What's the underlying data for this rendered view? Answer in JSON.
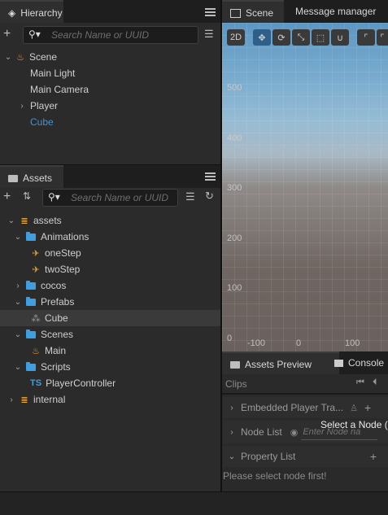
{
  "hierarchy": {
    "tab": "Hierarchy",
    "search_placeholder": "Search Name or UUID",
    "nodes": [
      {
        "label": "Scene",
        "color": "#cfcfcf"
      },
      {
        "label": "Main Light",
        "color": "#cfcfcf"
      },
      {
        "label": "Main Camera",
        "color": "#cfcfcf"
      },
      {
        "label": "Player",
        "color": "#cfcfcf"
      },
      {
        "label": "Cube",
        "color": "#4a90c8"
      }
    ]
  },
  "assets": {
    "tab": "Assets",
    "search_placeholder": "Search Name or UUID",
    "tree": [
      {
        "label": "assets"
      },
      {
        "label": "Animations"
      },
      {
        "label": "oneStep"
      },
      {
        "label": "twoStep"
      },
      {
        "label": "cocos"
      },
      {
        "label": "Prefabs"
      },
      {
        "label": "Cube"
      },
      {
        "label": "Scenes"
      },
      {
        "label": "Main"
      },
      {
        "label": "Scripts"
      },
      {
        "label": "PlayerController"
      },
      {
        "label": "internal"
      }
    ],
    "ts_badge": "TS"
  },
  "scene": {
    "tabs": [
      "Scene",
      "Message manager"
    ],
    "toolbar_2d": "2D",
    "y_ticks": [
      "500",
      "400",
      "300",
      "200",
      "100",
      "0"
    ],
    "x_ticks": [
      "-100",
      "0",
      "100"
    ]
  },
  "bottom": {
    "tabs": [
      "Assets Preview",
      "Console"
    ],
    "clips_label": "Clips",
    "embedded_label": "Embedded Player Tra...",
    "node_list_label": "Node List",
    "node_list_placeholder": "Enter Node na",
    "select_node_text": "Select a Node (",
    "property_list_label": "Property List",
    "please_select": "Please select node first!"
  },
  "colors": {
    "accent": "#3d9fe0",
    "selected_node": "#4a90c8",
    "sky_top": "#6fa6cc",
    "ground": "#6b625f"
  }
}
